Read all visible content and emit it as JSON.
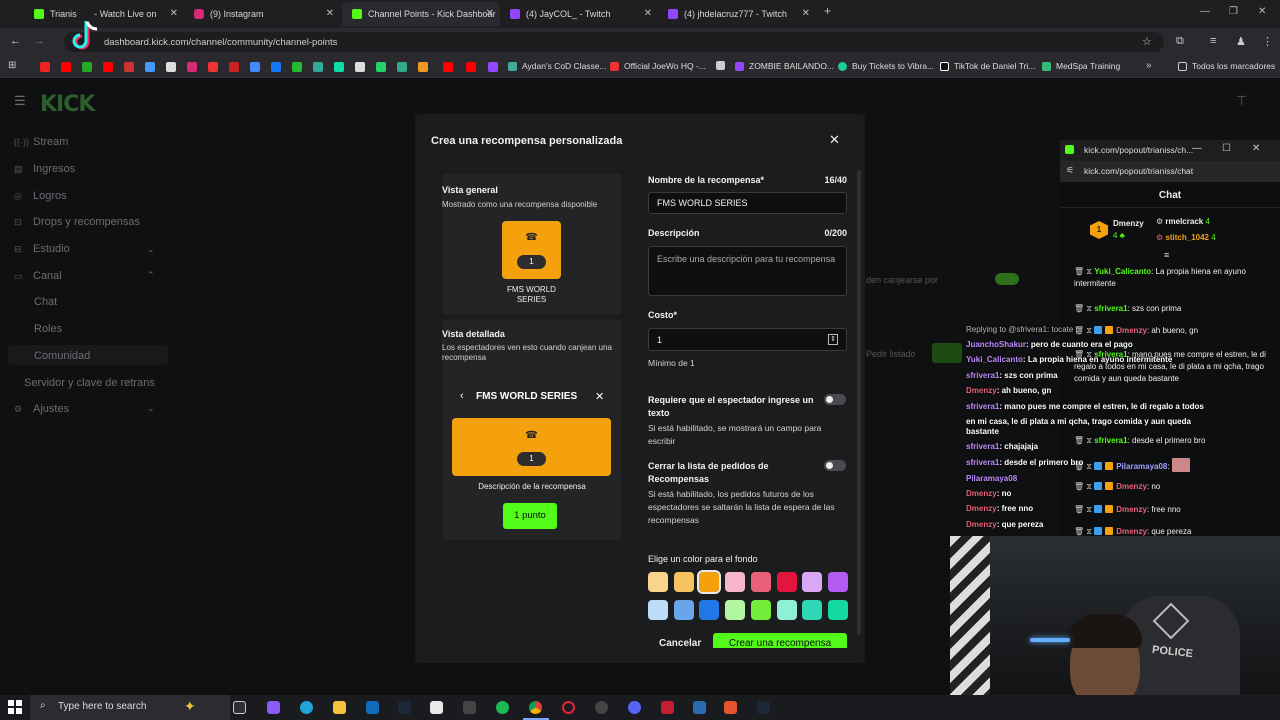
{
  "browser": {
    "tabs": [
      {
        "label": "Trianis",
        "suffix": "Watch Live on",
        "color": "#53fc18"
      },
      {
        "label": "(9) Instagram",
        "color": "#d62976"
      },
      {
        "label": "Channel Points - Kick Dashboar",
        "color": "#53fc18"
      },
      {
        "label": "(4) JayCOL_ - Twitch",
        "color": "#9146ff"
      },
      {
        "label": "(4) jhdelacruz777 - Twitch",
        "color": "#9146ff"
      }
    ],
    "url": "dashboard.kick.com/channel/community/channel-points",
    "bookmarks": [
      "Aydan's CoD Classe...",
      "Official JoeWo HQ -...",
      "ZOMBIE BAILANDO...",
      "Buy Tickets to Vibra...",
      "TikTok de Daniel Tri...",
      "MedSpa Training",
      "Todos los marcadores"
    ]
  },
  "sidebar": {
    "logo": "KICK",
    "items": [
      {
        "label": "Stream",
        "icon": "stream-icon"
      },
      {
        "label": "Ingresos",
        "icon": "money-icon"
      },
      {
        "label": "Logros",
        "icon": "trophy-icon"
      },
      {
        "label": "Drops y recompensas",
        "icon": "gift-icon"
      },
      {
        "label": "Estudio",
        "icon": "studio-icon"
      },
      {
        "label": "Canal",
        "icon": "channel-icon"
      }
    ],
    "sub_items": [
      "Chat",
      "Roles",
      "Comunidad"
    ],
    "bottom_items": [
      "Servidor y clave de retrans",
      "Ajustes"
    ]
  },
  "background_peek": {
    "text1": "den canjearse por",
    "text2": "Pedir listado"
  },
  "modal": {
    "title": "Crea una recompensa personalizada",
    "overview": {
      "title": "Vista general",
      "subtitle": "Mostrado como una recompensa disponible",
      "cost": "1",
      "name": "FMS WORLD SERIES"
    },
    "detail": {
      "title": "Vista detallada",
      "subtitle": "Los espectadores ven esto cuando canjean una recompensa",
      "name": "FMS WORLD SERIES",
      "cost": "1",
      "description": "Descripción de la recompensa",
      "button": "1 punto"
    },
    "form": {
      "name_label": "Nombre de la recompensa*",
      "name_counter": "16/40",
      "name_value": "FMS WORLD SERIES",
      "desc_label": "Descripción",
      "desc_counter": "0/200",
      "desc_placeholder": "Escribe una descripción para tu recompensa",
      "cost_label": "Costo*",
      "cost_value": "1",
      "cost_helper": "Mínimo de 1",
      "require_input_label": "Requiere que el espectador ingrese un texto",
      "require_input_helper": "Si está habilitado, se mostrará un campo para escribir",
      "skip_queue_label": "Cerrar la lista de pedidos de Recompensas",
      "skip_queue_helper": "Si está habilitado, los pedidos futuros de los espectadores se saltarán la lista de espera de las recompensas",
      "color_label": "Elige un color para el fondo",
      "colors": [
        "#fbd38d",
        "#f6c25f",
        "#f5a10d",
        "#f7b6c8",
        "#e8607a",
        "#e3153f",
        "#d9a8f5",
        "#b35cf2",
        "#bcdcf7",
        "#6aa4ea",
        "#1f78e6",
        "#b2f7a0",
        "#74ec3a",
        "#8ff0d8",
        "#2fd6b4",
        "#13d9a0"
      ],
      "selected_color": "#f5a10d",
      "cancel": "Cancelar",
      "create": "Crear una recompensa"
    }
  },
  "chat": {
    "window_title": "kick.com/popout/trianiss/ch...",
    "url": "kick.com/popout/trianiss/chat",
    "header": "Chat",
    "top_gifters": [
      {
        "name": "Dmenzy",
        "count": "4"
      },
      {
        "name": "rmelcrack",
        "count": "4"
      },
      {
        "name": "stitch_1042",
        "count": "4"
      }
    ],
    "messages": [
      {
        "user": "Yuki_Calicanto",
        "user_color": "#53fc18",
        "text": "La propia hiena en ayuno intermitente"
      },
      {
        "user": "sfrivera1",
        "user_color": "#53fc18",
        "text": "szs con prima"
      },
      {
        "user": "Dmenzy",
        "user_color": "#e8607a",
        "text": "ah bueno, gn"
      },
      {
        "user": "sfrivera1",
        "user_color": "#53fc18",
        "text": "mano pues me compre el estren, le di regalo a todos en mi casa, le di plata a mi qcha, trago comida y aun queda bastante"
      },
      {
        "user": "sfrivera1",
        "user_color": "#53fc18",
        "text": "desde el primero bro"
      },
      {
        "user": "Pilaramaya08",
        "user_color": "#9fa3ff",
        "text": ""
      },
      {
        "user": "Dmenzy",
        "user_color": "#e8607a",
        "text": "no"
      },
      {
        "user": "Dmenzy",
        "user_color": "#e8607a",
        "text": "free nno"
      },
      {
        "user": "Dmenzy",
        "user_color": "#e8607a",
        "text": "que pereza"
      }
    ]
  },
  "overlay_chat": [
    {
      "user": "Replying to @sfrivera1: tocate pr",
      "text": ""
    },
    {
      "user": "JuanchoShakur",
      "text": "pero de cuanto era el pago"
    },
    {
      "user": "Yuki_Calicanto",
      "text": "La propia hiena en ayuno intermitente"
    },
    {
      "user": "sfrivera1",
      "text": "szs con prima"
    },
    {
      "user": "Dmenzy",
      "text": "ah bueno, gn"
    },
    {
      "user": "sfrivera1",
      "text": "mano pues me compre el estren, le di regalo a todos"
    },
    {
      "user": "",
      "text": "en mi casa, le di plata a mi qcha, trago comida y aun queda"
    },
    {
      "user": "",
      "text": "bastante"
    },
    {
      "user": "sfrivera1",
      "text": "chajajaja"
    },
    {
      "user": "sfrivera1",
      "text": "desde el primero bro"
    },
    {
      "user": "Pilaramaya08",
      "text": ""
    },
    {
      "user": "Dmenzy",
      "text": "no"
    },
    {
      "user": "Dmenzy",
      "text": "free nno"
    },
    {
      "user": "Dmenzy",
      "text": "que pereza"
    }
  ],
  "taskbar": {
    "search_placeholder": "Type here to search"
  }
}
